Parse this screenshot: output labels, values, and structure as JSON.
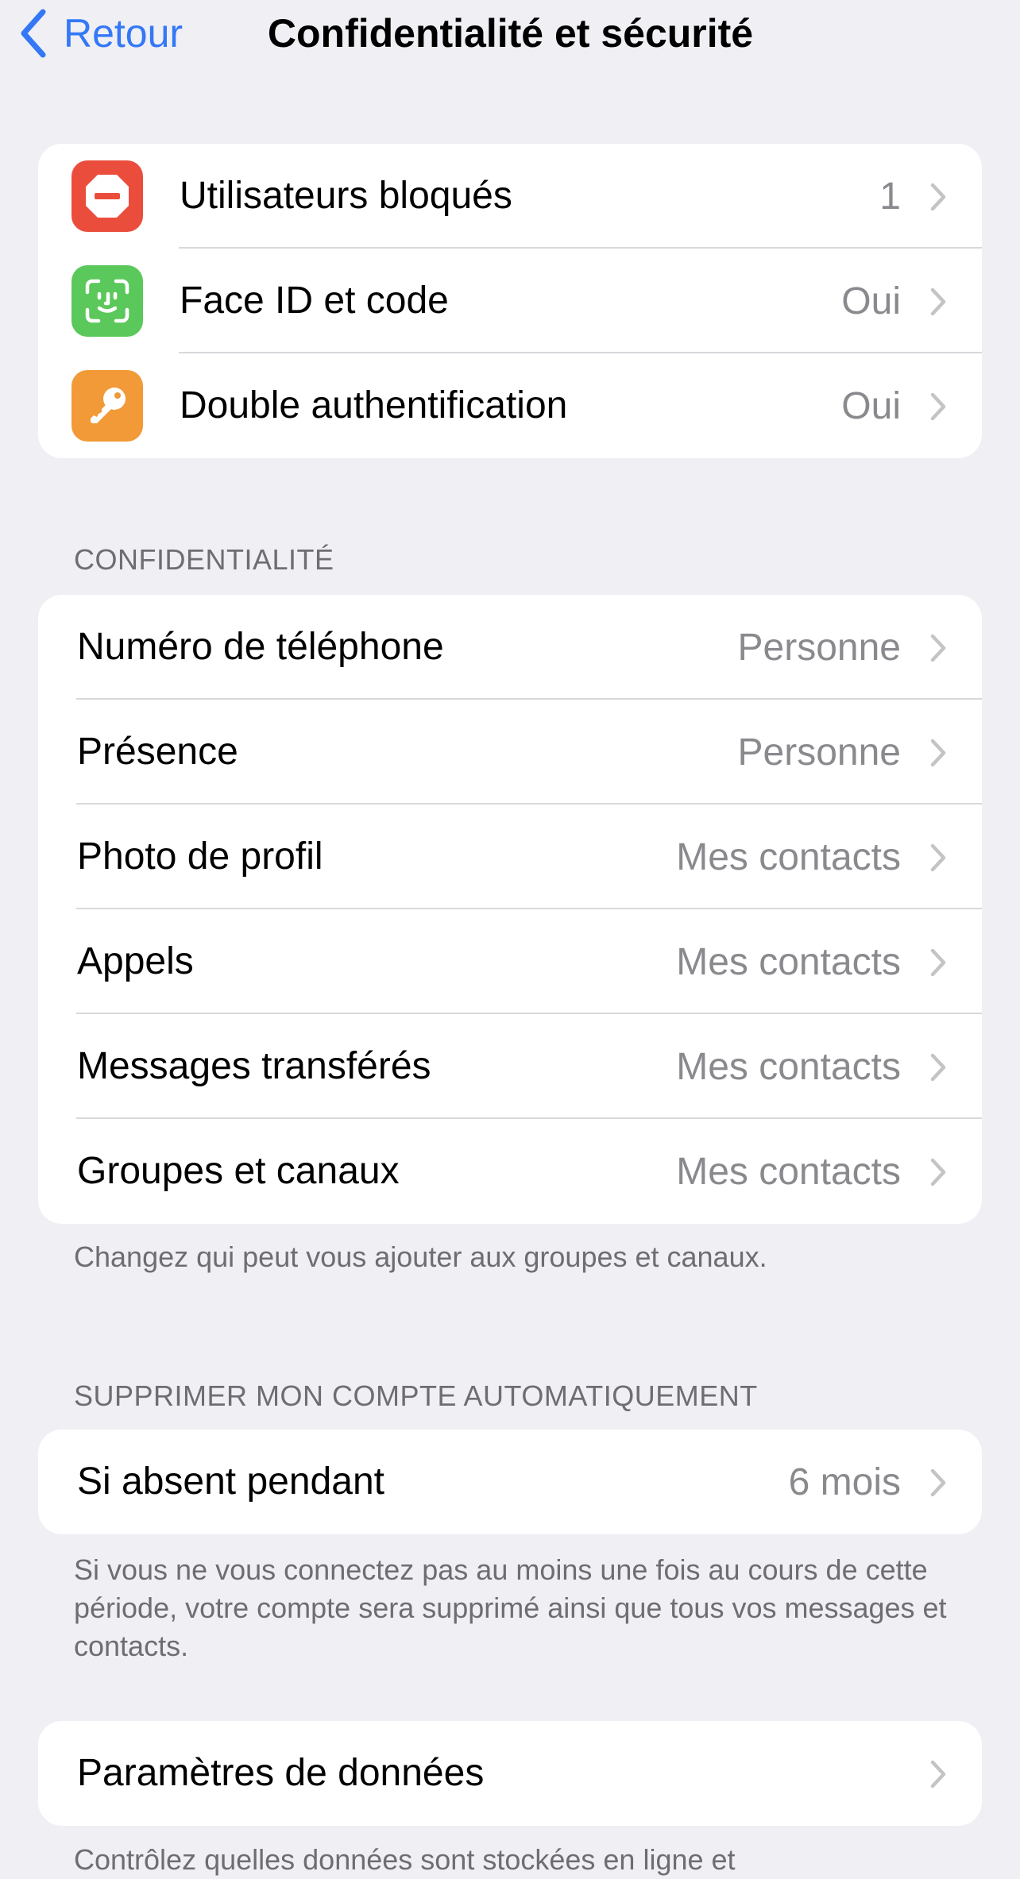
{
  "nav": {
    "back_label": "Retour",
    "title": "Confidentialité et sécurité"
  },
  "security": {
    "items": [
      {
        "label": "Utilisateurs bloqués",
        "value": "1",
        "icon": "blocked-icon",
        "color": "#eb4d3d"
      },
      {
        "label": "Face ID et code",
        "value": "Oui",
        "icon": "face-id-icon",
        "color": "#5ac85a"
      },
      {
        "label": "Double authentification",
        "value": "Oui",
        "icon": "key-icon",
        "color": "#f19a37"
      }
    ]
  },
  "privacy": {
    "header": "CONFIDENTIALITÉ",
    "items": [
      {
        "label": "Numéro de téléphone",
        "value": "Personne"
      },
      {
        "label": "Présence",
        "value": "Personne"
      },
      {
        "label": "Photo de profil",
        "value": "Mes contacts"
      },
      {
        "label": "Appels",
        "value": "Mes contacts"
      },
      {
        "label": "Messages transférés",
        "value": "Mes contacts"
      },
      {
        "label": "Groupes et canaux",
        "value": "Mes contacts"
      }
    ],
    "footer": "Changez qui peut vous ajouter aux groupes et canaux."
  },
  "auto_delete": {
    "header": "SUPPRIMER MON COMPTE AUTOMATIQUEMENT",
    "item": {
      "label": "Si absent pendant",
      "value": "6 mois"
    },
    "footer": "Si vous ne vous connectez pas au moins une fois au cours de cette période, votre compte sera supprimé ainsi que tous vos messages et contacts."
  },
  "data_settings": {
    "label": "Paramètres de données",
    "footer": "Contrôlez quelles données sont stockées en ligne et"
  },
  "colors": {
    "accent": "#3478f6",
    "background": "#efeff4",
    "secondary_text": "#8a8a8e",
    "chevron": "#c4c4c7"
  }
}
